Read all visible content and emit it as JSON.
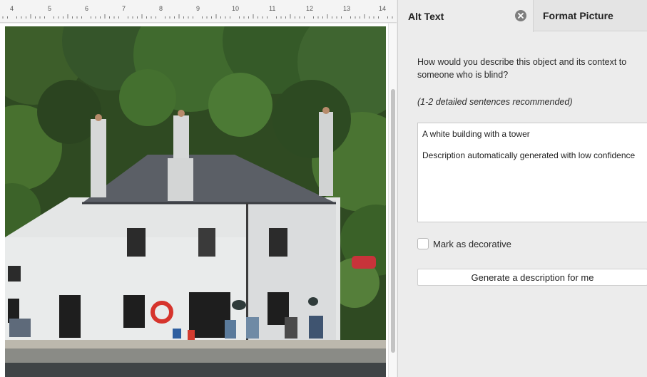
{
  "ruler": {
    "numbers": [
      "4",
      "5",
      "6",
      "7",
      "8",
      "9",
      "10",
      "11",
      "12",
      "13",
      "14"
    ]
  },
  "image": {
    "semantic": "photo-of-white-canal-house"
  },
  "pane": {
    "tab_alt_text": "Alt Text",
    "tab_format_picture": "Format Picture",
    "close_icon": "close-icon",
    "prompt": "How would you describe this object and its context to someone who is blind?",
    "hint": "(1-2 detailed sentences recommended)",
    "alt_text_line1": "A white building with a tower",
    "alt_text_line2": "Description automatically generated with low confidence",
    "decorative_label": "Mark as decorative",
    "decorative_checked": false,
    "generate_button": "Generate a description for me"
  },
  "colors": {
    "pane_bg": "#ececec",
    "close_icon_bg": "#7e7e7e"
  }
}
